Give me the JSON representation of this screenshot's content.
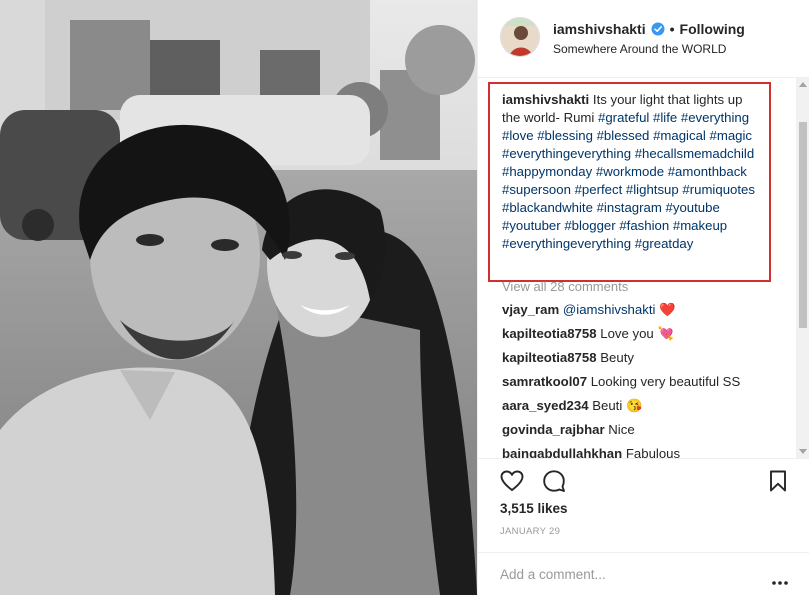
{
  "post": {
    "username": "iamshivshakti",
    "follow_state": "Following",
    "separator": "•",
    "location": "Somewhere Around the WORLD"
  },
  "caption": {
    "username": "iamshivshakti",
    "text": "Its your light that lights up the world- Rumi",
    "hashtags": [
      "#grateful",
      "#life",
      "#everything",
      "#love",
      "#blessing",
      "#blessed",
      "#magical",
      "#magic",
      "#everythingeverything",
      "#hecallsmemadchild",
      "#happymonday",
      "#workmode",
      "#amonthback",
      "#supersoon",
      "#perfect",
      "#lightsup",
      "#rumiquotes",
      "#blackandwhite",
      "#instagram",
      "#youtube",
      "#youtuber",
      "#blogger",
      "#fashion",
      "#makeup",
      "#everythingeverything",
      "#greatday"
    ]
  },
  "comments": {
    "view_all": "View all 28 comments",
    "items": [
      {
        "user": "vjay_ram",
        "text": "@iamshivshakti",
        "emoji": "❤️"
      },
      {
        "user": "kapilteotia8758",
        "text": "Love you",
        "emoji": "💘"
      },
      {
        "user": "kapilteotia8758",
        "text": "Beuty",
        "emoji": ""
      },
      {
        "user": "samratkool07",
        "text": "Looking very beautiful SS",
        "emoji": ""
      },
      {
        "user": "aara_syed234",
        "text": "Beuti",
        "emoji": "😘"
      },
      {
        "user": "govinda_rajbhar",
        "text": "Nice",
        "emoji": ""
      },
      {
        "user": "baingabdullahkhan",
        "text": "Fabulous",
        "emoji": ""
      }
    ]
  },
  "stats": {
    "likes": "3,515 likes",
    "date": "JANUARY 29"
  },
  "add_comment": {
    "placeholder": "Add a comment..."
  },
  "icons": {
    "verified": "verified-badge-icon",
    "like": "heart-icon",
    "comment": "comment-bubble-icon",
    "save": "bookmark-icon",
    "more": "more-options-icon"
  },
  "colors": {
    "highlight_border": "#d32f2f",
    "link": "#003569",
    "verified_blue": "#3897f0",
    "muted_text": "#999999"
  }
}
